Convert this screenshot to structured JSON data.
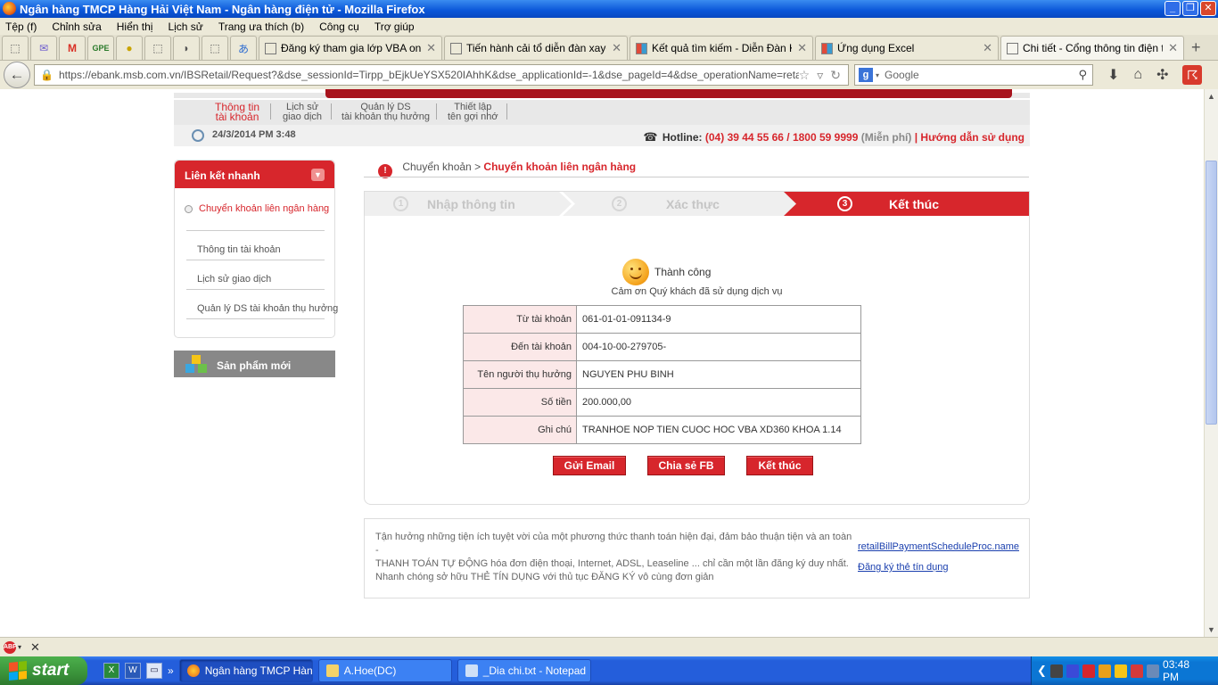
{
  "window": {
    "title": "Ngân hàng TMCP Hàng Hải Việt Nam - Ngân hàng điện tử - Mozilla Firefox"
  },
  "menu": [
    "Tệp (f)",
    "Chỉnh sửa",
    "Hiển thị",
    "Lịch sử",
    "Trang ưa thích (b)",
    "Công cụ",
    "Trợ giúp"
  ],
  "tabs": [
    {
      "label": "Đăng ký tham gia lớp VBA online ..."
    },
    {
      "label": "Tiến hành cải tổ diễn đàn xaydu..."
    },
    {
      "label": "Kết quả tìm kiếm - Diễn Đàn Kế T..."
    },
    {
      "label": "Ứng dụng Excel"
    },
    {
      "label": "Chi tiết - Cổng thông tin điện tử"
    }
  ],
  "nav": {
    "url": "https://ebank.msb.com.vn/IBSRetail/Request?&dse_sessionId=Tirpp_bEjkUeYSX520IAhhK&dse_applicationId=-1&dse_pageId=4&dse_operationName=retailHomeProc&dse",
    "search_placeholder": "Google"
  },
  "subnav": {
    "items": [
      {
        "line1": "Thông tin",
        "line2": "tài khoản"
      },
      {
        "line1": "Lịch sử",
        "line2": "giao dịch"
      },
      {
        "line1": "Quản lý DS",
        "line2": "tài khoản thụ hưởng"
      },
      {
        "line1": "Thiết lập",
        "line2": "tên gợi nhớ"
      }
    ]
  },
  "datetime": "24/3/2014 PM 3:48",
  "hotline": {
    "label": "Hotline:",
    "number": "(04) 39 44 55 66 / 1800 59 9999",
    "free": "(Miễn phí)",
    "separator": "|",
    "guide": "Hướng dẫn sử dụng"
  },
  "sidebar": {
    "title": "Liên kết nhanh",
    "items": [
      {
        "label": "Chuyển khoản liên ngân hàng"
      },
      {
        "label": "Thông tin tài khoản"
      },
      {
        "label": "Lịch sử giao dịch"
      },
      {
        "label": "Quản lý DS tài khoản thụ hưởng"
      }
    ],
    "new_products": "Sản phẩm mới"
  },
  "breadcrumb": {
    "parent": "Chuyển khoản >",
    "current": "Chuyển khoản liên ngân hàng"
  },
  "steps": [
    {
      "num": "1",
      "label": "Nhập thông tin"
    },
    {
      "num": "2",
      "label": "Xác thực"
    },
    {
      "num": "3",
      "label": "Kết thúc"
    }
  ],
  "result": {
    "status": "Thành công",
    "thanks": "Cảm ơn Quý khách đã sử dụng dịch vụ",
    "rows": [
      {
        "label": "Từ tài khoản",
        "value": "061-01-01-091134-9"
      },
      {
        "label": "Đến tài khoản",
        "value": "004-10-00-279705-"
      },
      {
        "label": "Tên người thụ hưởng",
        "value": "NGUYEN PHU BINH"
      },
      {
        "label": "Số tiền",
        "value": "200.000,00"
      },
      {
        "label": "Ghi chú",
        "value": "TRANHOE NOP TIEN CUOC HOC VBA XD360 KHOA 1.14"
      }
    ],
    "buttons": [
      "Gửi Email",
      "Chia sẻ FB",
      "Kết thúc"
    ]
  },
  "promo": {
    "line1": "Tận hưởng những tiện ích tuyệt vời của một phương thức thanh toán hiện đại, đảm bảo thuận tiện và an toàn -",
    "line2": "THANH TOÁN TỰ ĐỘNG hóa đơn điện thoại, Internet, ADSL, Leaseline ... chỉ cần một lần đăng ký duy nhất.",
    "line3": "Nhanh chóng sở hữu THẺ TÍN DỤNG với thủ tục ĐĂNG KÝ vô cùng đơn giản",
    "link1": "retailBillPaymentScheduleProc.name",
    "link2": "Đăng ký thẻ tín dụng"
  },
  "taskbar": {
    "start": "start",
    "tasks": [
      {
        "label": "Ngân hàng TMCP Hàn..."
      },
      {
        "label": "A.Hoe(DC)"
      },
      {
        "label": "_Dia chi.txt - Notepad"
      }
    ],
    "clock": "03:48 PM"
  },
  "colors": {
    "brand_red": "#d7262c",
    "xp_blue": "#245edb"
  }
}
